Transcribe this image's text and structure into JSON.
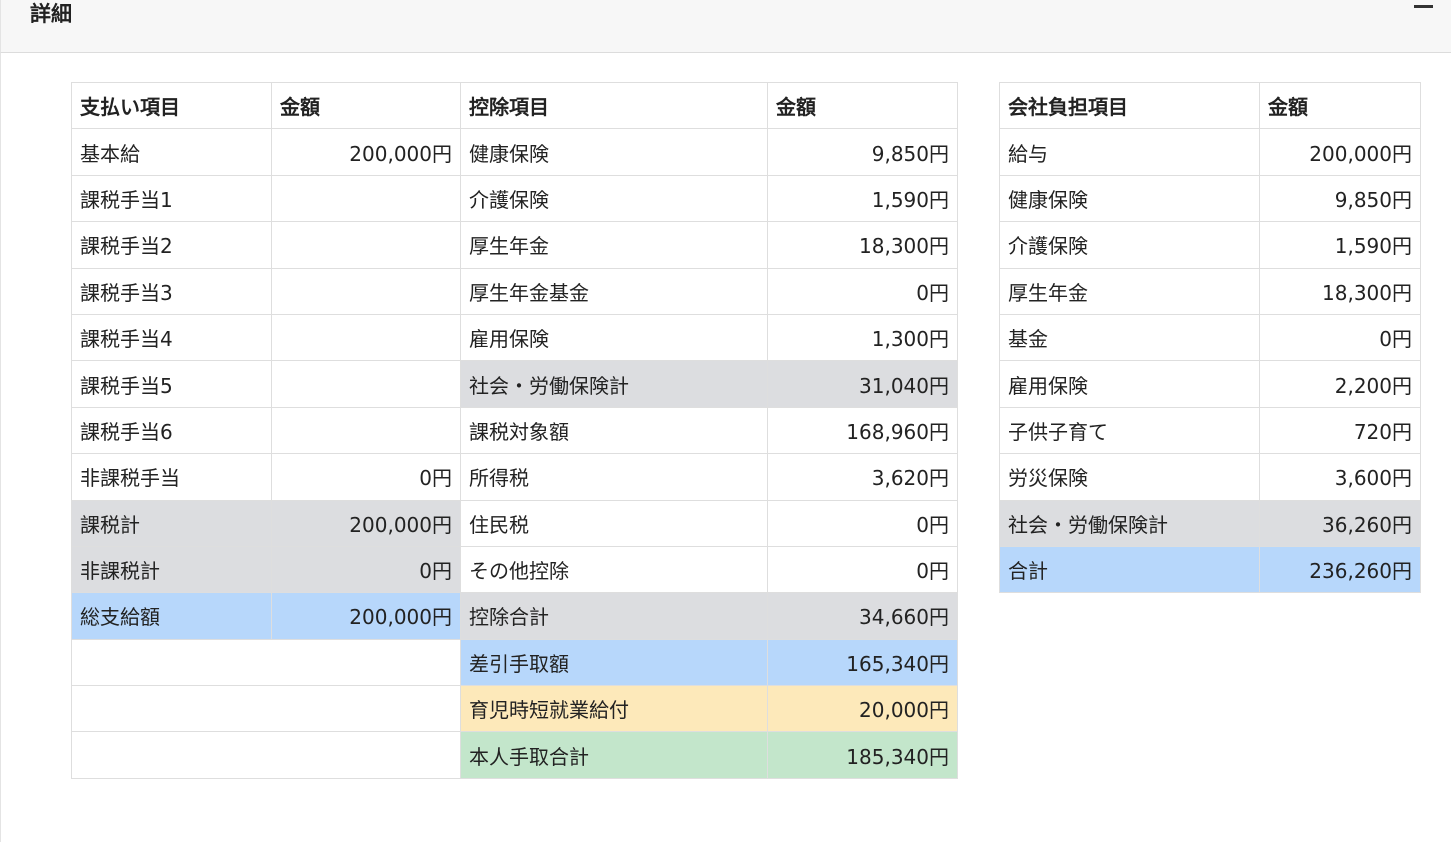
{
  "panel": {
    "title": "詳細"
  },
  "main_table": {
    "headers": [
      "支払い項目",
      "金額",
      "控除項目",
      "金額"
    ],
    "rows": [
      {
        "pay": "基本給",
        "pay_amount": "200,000円",
        "ded": "健康保険",
        "ded_amount": "9,850円"
      },
      {
        "pay": "課税手当1",
        "pay_amount": "",
        "ded": "介護保険",
        "ded_amount": "1,590円"
      },
      {
        "pay": "課税手当2",
        "pay_amount": "",
        "ded": "厚生年金",
        "ded_amount": "18,300円"
      },
      {
        "pay": "課税手当3",
        "pay_amount": "",
        "ded": "厚生年金基金",
        "ded_amount": "0円"
      },
      {
        "pay": "課税手当4",
        "pay_amount": "",
        "ded": "雇用保険",
        "ded_amount": "1,300円"
      },
      {
        "pay": "課税手当5",
        "pay_amount": "",
        "ded": "社会・労働保険計",
        "ded_amount": "31,040円"
      },
      {
        "pay": "課税手当6",
        "pay_amount": "",
        "ded": "課税対象額",
        "ded_amount": "168,960円"
      },
      {
        "pay": "非課税手当",
        "pay_amount": "0円",
        "ded": "所得税",
        "ded_amount": "3,620円"
      },
      {
        "pay": "課税計",
        "pay_amount": "200,000円",
        "ded": "住民税",
        "ded_amount": "0円"
      },
      {
        "pay": "非課税計",
        "pay_amount": "0円",
        "ded": "その他控除",
        "ded_amount": "0円"
      },
      {
        "pay": "総支給額",
        "pay_amount": "200,000円",
        "ded": "控除合計",
        "ded_amount": "34,660円"
      },
      {
        "pay": "",
        "pay_amount": "",
        "ded": "差引手取額",
        "ded_amount": "165,340円"
      },
      {
        "pay": "",
        "pay_amount": "",
        "ded": "育児時短就業給付",
        "ded_amount": "20,000円"
      },
      {
        "pay": "",
        "pay_amount": "",
        "ded": "本人手取合計",
        "ded_amount": "185,340円"
      }
    ]
  },
  "company_table": {
    "headers": [
      "会社負担項目",
      "金額"
    ],
    "rows": [
      {
        "item": "給与",
        "amount": "200,000円"
      },
      {
        "item": "健康保険",
        "amount": "9,850円"
      },
      {
        "item": "介護保険",
        "amount": "1,590円"
      },
      {
        "item": "厚生年金",
        "amount": "18,300円"
      },
      {
        "item": "基金",
        "amount": "0円"
      },
      {
        "item": "雇用保険",
        "amount": "2,200円"
      },
      {
        "item": "子供子育て",
        "amount": "720円"
      },
      {
        "item": "労災保険",
        "amount": "3,600円"
      },
      {
        "item": "社会・労働保険計",
        "amount": "36,260円"
      },
      {
        "item": "合計",
        "amount": "236,260円"
      }
    ]
  },
  "colors": {
    "subtotal_gray": "#dcdde0",
    "total_blue": "#b7d7fb",
    "benefit_yellow": "#fde9ba",
    "net_green": "#c3e6cb"
  },
  "icons": {
    "collapse": "minus-icon"
  }
}
